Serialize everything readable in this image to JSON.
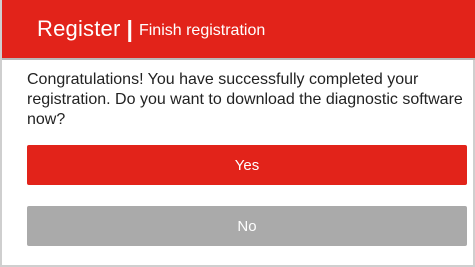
{
  "header": {
    "title": "Register",
    "separator": "|",
    "subtitle": "Finish registration"
  },
  "message": "Congratulations! You have successfully completed your registration. Do you want to download the diagnostic software now?",
  "buttons": {
    "yes_label": "Yes",
    "no_label": "No"
  },
  "colors": {
    "accent": "#e2231a",
    "disabled_button": "#aaaaaa"
  }
}
